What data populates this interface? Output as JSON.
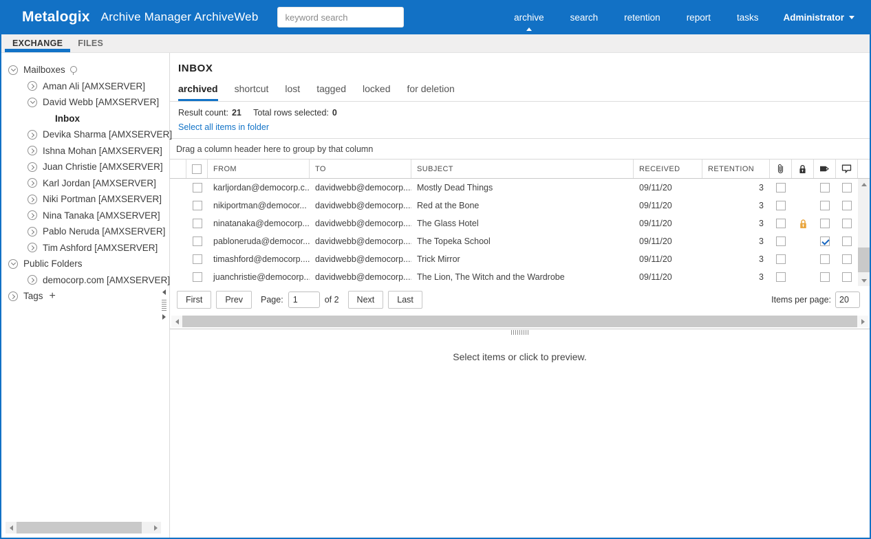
{
  "appearance": {
    "brand_blue": "#1271c5",
    "link_blue": "#1273c7",
    "active_tab_underline": "#1273c7",
    "lock_orange": "#e9a63f",
    "checked_check_blue": "#1565c0"
  },
  "topbar": {
    "brand": "Metalogix",
    "app_title": "Archive Manager ArchiveWeb",
    "search_placeholder": "keyword search",
    "nav": [
      {
        "label": "archive",
        "active": true
      },
      {
        "label": "search",
        "active": false
      },
      {
        "label": "retention",
        "active": false
      },
      {
        "label": "report",
        "active": false
      },
      {
        "label": "tasks",
        "active": false
      }
    ],
    "user_menu": "Administrator"
  },
  "module_tabs": [
    {
      "label": "EXCHANGE",
      "active": true
    },
    {
      "label": "FILES",
      "active": false
    }
  ],
  "sidebar": {
    "tree": [
      {
        "label": "Mailboxes",
        "level": 0,
        "state": "expanded",
        "pinned": true
      },
      {
        "label": "Aman Ali [AMXSERVER]",
        "level": 1,
        "state": "collapsed"
      },
      {
        "label": "David Webb [AMXSERVER]",
        "level": 1,
        "state": "expanded"
      },
      {
        "label": "Inbox",
        "level": 2,
        "state": "leaf",
        "selected": true
      },
      {
        "label": "Devika Sharma [AMXSERVER]",
        "level": 1,
        "state": "collapsed"
      },
      {
        "label": "Ishna Mohan [AMXSERVER]",
        "level": 1,
        "state": "collapsed"
      },
      {
        "label": "Juan Christie [AMXSERVER]",
        "level": 1,
        "state": "collapsed"
      },
      {
        "label": "Karl Jordan [AMXSERVER]",
        "level": 1,
        "state": "collapsed"
      },
      {
        "label": "Niki Portman [AMXSERVER]",
        "level": 1,
        "state": "collapsed"
      },
      {
        "label": "Nina Tanaka [AMXSERVER]",
        "level": 1,
        "state": "collapsed"
      },
      {
        "label": "Pablo Neruda [AMXSERVER]",
        "level": 1,
        "state": "collapsed"
      },
      {
        "label": "Tim Ashford [AMXSERVER]",
        "level": 1,
        "state": "collapsed"
      },
      {
        "label": "Public Folders",
        "level": 0,
        "state": "expanded"
      },
      {
        "label": "democorp.com [AMXSERVER]",
        "level": 1,
        "state": "collapsed"
      },
      {
        "label": "Tags",
        "level": 0,
        "state": "collapsed",
        "add_icon": "+"
      }
    ]
  },
  "main": {
    "folder_title": "INBOX",
    "view_tabs": [
      {
        "label": "archived",
        "active": true
      },
      {
        "label": "shortcut",
        "active": false
      },
      {
        "label": "lost",
        "active": false
      },
      {
        "label": "tagged",
        "active": false
      },
      {
        "label": "locked",
        "active": false
      },
      {
        "label": "for deletion",
        "active": false
      }
    ],
    "result_count_label": "Result count:",
    "result_count": "21",
    "rows_selected_label": "Total rows selected:",
    "rows_selected": "0",
    "select_all_link": "Select all items in folder",
    "group_hint": "Drag a column header here to group by that column",
    "grid": {
      "columns": {
        "from": "FROM",
        "to": "TO",
        "subject": "SUBJECT",
        "received": "RECEIVED",
        "retention": "RETENTION"
      },
      "icon_columns": [
        "attachment",
        "lock",
        "tag",
        "comment"
      ],
      "rows": [
        {
          "from": "karljordan@democorp.c...",
          "to": "davidwebb@democorp....",
          "subject": "Mostly Dead Things",
          "received": "09/11/20",
          "retention": "3",
          "locked": false,
          "tagged": false
        },
        {
          "from": "nikiportman@democor...",
          "to": "davidwebb@democorp....",
          "subject": "Red at the Bone",
          "received": "09/11/20",
          "retention": "3",
          "locked": false,
          "tagged": false
        },
        {
          "from": "ninatanaka@democorp....",
          "to": "davidwebb@democorp....",
          "subject": "The Glass Hotel",
          "received": "09/11/20",
          "retention": "3",
          "locked": true,
          "tagged": false
        },
        {
          "from": "pabloneruda@democor...",
          "to": "davidwebb@democorp....",
          "subject": "The Topeka School",
          "received": "09/11/20",
          "retention": "3",
          "locked": false,
          "tagged": true
        },
        {
          "from": "timashford@democorp....",
          "to": "davidwebb@democorp....",
          "subject": "Trick Mirror",
          "received": "09/11/20",
          "retention": "3",
          "locked": false,
          "tagged": false
        },
        {
          "from": "juanchristie@democorp....",
          "to": "davidwebb@democorp....",
          "subject": "The Lion, The Witch and the Wardrobe",
          "received": "09/11/20",
          "retention": "3",
          "locked": false,
          "tagged": false
        }
      ]
    },
    "pagination": {
      "first": "First",
      "prev": "Prev",
      "page_label": "Page:",
      "page_value": "1",
      "of_label": "of 2",
      "next": "Next",
      "last": "Last",
      "items_per_page_label": "Items per page:",
      "items_per_page_value": "20"
    },
    "preview_hint": "Select items or click to preview."
  }
}
